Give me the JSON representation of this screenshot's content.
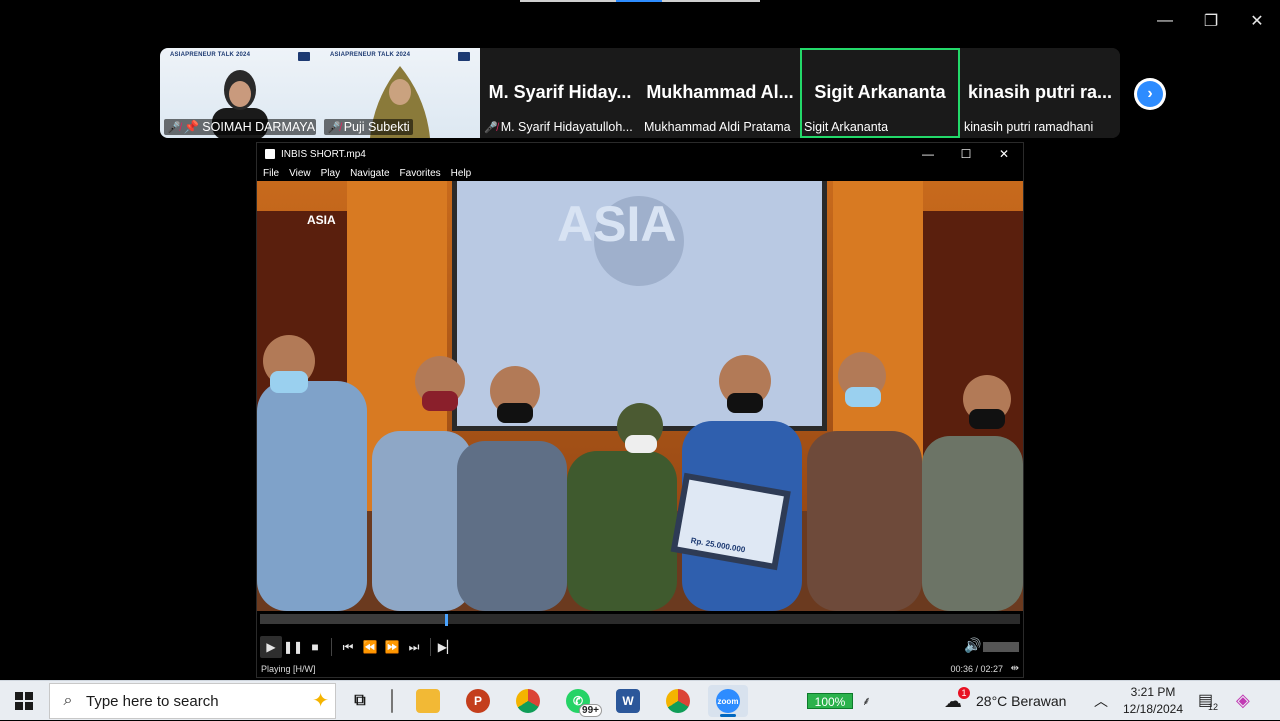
{
  "window_controls": {
    "minimize": "—",
    "restore": "❐",
    "close": "✕"
  },
  "gallery": {
    "tiles": [
      {
        "type": "video",
        "banner": "ASIAPRENEUR TALK 2024",
        "label": "SOIMAH DARMAYA...",
        "muted": true,
        "pinned": true
      },
      {
        "type": "video",
        "banner": "ASIAPRENEUR TALK 2024",
        "label": "Puji Subekti",
        "muted": true,
        "pinned": false
      },
      {
        "type": "name",
        "big": "M. Syarif Hiday...",
        "label": "M. Syarif Hidayatulloh...",
        "muted": true
      },
      {
        "type": "name",
        "big": "Mukhammad Al...",
        "label": "Mukhammad Aldi Pratama",
        "muted": false
      },
      {
        "type": "name",
        "big": "Sigit Arkananta",
        "label": "Sigit Arkananta",
        "muted": false,
        "active": true
      },
      {
        "type": "name",
        "big": "kinasih putri ra...",
        "label": "kinasih putri ramadhani",
        "muted": false
      }
    ],
    "next_icon": "chevron-right-icon"
  },
  "player": {
    "title": "INBIS SHORT.mp4",
    "menu": [
      "File",
      "View",
      "Play",
      "Navigate",
      "Favorites",
      "Help"
    ],
    "status": "Playing [H/W]",
    "time": "00:36 / 02:27",
    "progress": 0.245,
    "video": {
      "watermark": "ASIA",
      "certificate_amount": "Rp. 25.000.000"
    }
  },
  "taskbar": {
    "search_placeholder": "Type here to search",
    "whatsapp_badge": "99+",
    "battery": "100%",
    "weather": "28°C  Berawan",
    "weather_alert": "1",
    "time": "3:21 PM",
    "date": "12/18/2024",
    "notifications": "12",
    "accent": "#2d8cff",
    "active_speaker": "#23d96a"
  }
}
